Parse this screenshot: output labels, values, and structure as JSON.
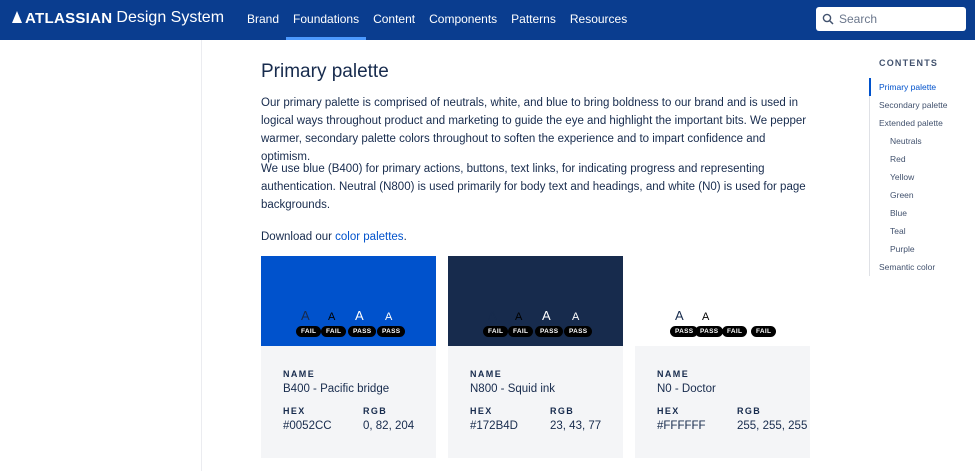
{
  "topbar": {
    "logo_word": "ATLASSIAN",
    "logo_sub": "Design System",
    "nav": [
      "Brand",
      "Foundations",
      "Content",
      "Components",
      "Patterns",
      "Resources"
    ],
    "search_placeholder": "Search"
  },
  "main": {
    "title": "Primary palette",
    "para1": "Our primary palette is comprised of neutrals, white, and blue to bring boldness to our brand and is used in logical ways throughout product and marketing to guide the eye and highlight the important bits. We pepper warmer, secondary palette colors throughout to soften the experience and to impart confidence and optimism.",
    "para2": "We use blue (B400) for primary actions, buttons, text links, for indicating progress and representing authentication. Neutral (N800) is used primarily for body text and headings, and white (N0) is used for page backgrounds.",
    "download_prefix": "Download our ",
    "download_link": "color palettes",
    "download_suffix": "."
  },
  "cards": [
    {
      "swatch": "#0052CC",
      "letters": [
        "A",
        "A",
        "A",
        "A"
      ],
      "letter_colors": [
        "#172B4D",
        "#000000",
        "#FFFFFF",
        "#FFFFFF"
      ],
      "badges": [
        "FAIL",
        "FAIL",
        "PASS",
        "PASS"
      ],
      "name_label": "NAME",
      "name": "B400 - Pacific bridge",
      "hex_label": "HEX",
      "hex": "#0052CC",
      "rgb_label": "RGB",
      "rgb": "0, 82, 204"
    },
    {
      "swatch": "#172B4D",
      "letters": [
        "A",
        "A",
        "A",
        "A"
      ],
      "letter_colors": [
        "#172B4D",
        "#000000",
        "#FFFFFF",
        "#FFFFFF"
      ],
      "badges": [
        "FAIL",
        "FAIL",
        "PASS",
        "PASS"
      ],
      "name_label": "NAME",
      "name": "N800 - Squid ink",
      "hex_label": "HEX",
      "hex": "#172B4D",
      "rgb_label": "RGB",
      "rgb": "23, 43, 77"
    },
    {
      "swatch": "#FFFFFF",
      "letters": [
        "A",
        "A",
        "A",
        "A"
      ],
      "letter_colors": [
        "#172B4D",
        "#000000",
        "#FFFFFF",
        "#FFFFFF"
      ],
      "badges": [
        "PASS",
        "PASS",
        "FAIL",
        "FAIL"
      ],
      "name_label": "NAME",
      "name": "N0 - Doctor",
      "hex_label": "HEX",
      "hex": "#FFFFFF",
      "rgb_label": "RGB",
      "rgb": "255, 255, 255"
    }
  ],
  "toc": {
    "title": "CONTENTS",
    "items": [
      "Primary palette",
      "Secondary palette",
      "Extended palette",
      "Neutrals",
      "Red",
      "Yellow",
      "Green",
      "Blue",
      "Teal",
      "Purple",
      "Semantic color"
    ]
  },
  "colors": {
    "topbar": "#0A3D8F",
    "nav_active_underline": "#4C9AFF",
    "link": "#0052CC",
    "badge": "#000000"
  },
  "icons": {
    "search": "search-icon"
  }
}
